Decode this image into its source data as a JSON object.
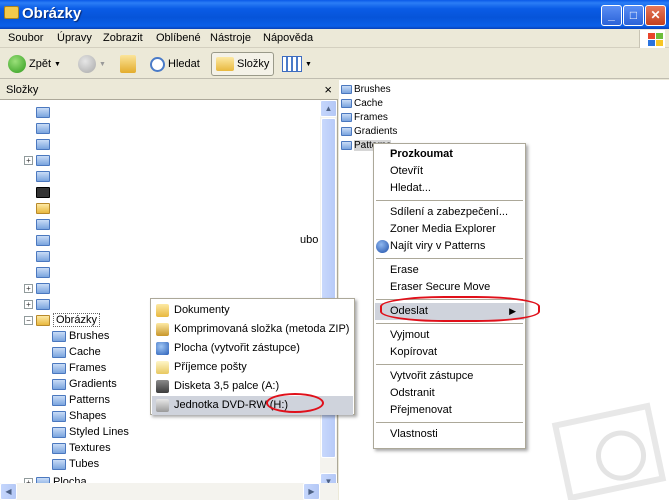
{
  "window": {
    "title": "Obrázky",
    "controls": [
      "minimize",
      "maximize",
      "close"
    ]
  },
  "menubar": [
    "Soubor",
    "Úpravy",
    "Zobrazit",
    "Oblíbené",
    "Nástroje",
    "Nápověda"
  ],
  "toolbar": {
    "back_label": "Zpět",
    "search_label": "Hledat",
    "folders_label": "Složky"
  },
  "folders_pane": {
    "header": "Složky",
    "close_glyph": "×",
    "partial_label": "ubo",
    "selected_folder": "Obrázky",
    "children": [
      "Brushes",
      "Cache",
      "Frames",
      "Gradients",
      "Patterns",
      "Shapes",
      "Styled Lines",
      "Textures",
      "Tubes"
    ],
    "bottom_item": "Plocha"
  },
  "right_pane": {
    "items": [
      "Brushes",
      "Cache",
      "Frames",
      "Gradients",
      "Patterns"
    ]
  },
  "context_menu": {
    "items": [
      {
        "label": "Prozkoumat",
        "bold": true
      },
      {
        "label": "Otevřít"
      },
      {
        "label": "Hledat..."
      },
      {
        "sep": true
      },
      {
        "label": "Sdílení a zabezpečení..."
      },
      {
        "label": "Zoner Media Explorer"
      },
      {
        "label": "Najít viry v Patterns",
        "icon": "antivirus-icon"
      },
      {
        "sep": true
      },
      {
        "label": "Erase"
      },
      {
        "label": "Eraser Secure Move"
      },
      {
        "sep": true
      },
      {
        "label": "Odeslat",
        "submenu": true,
        "selected": true
      },
      {
        "sep": true
      },
      {
        "label": "Vyjmout"
      },
      {
        "label": "Kopírovat"
      },
      {
        "sep": true
      },
      {
        "label": "Vytvořit zástupce"
      },
      {
        "label": "Odstranit"
      },
      {
        "label": "Přejmenovat"
      },
      {
        "sep": true
      },
      {
        "label": "Vlastnosti"
      }
    ]
  },
  "send_to_menu": {
    "items": [
      {
        "label": "Dokumenty",
        "icon": "documents-icon"
      },
      {
        "label": "Komprimovaná složka (metoda ZIP)",
        "icon": "zip-folder-icon"
      },
      {
        "label": "Plocha (vytvořit zástupce)",
        "icon": "desktop-icon"
      },
      {
        "label": "Příjemce pošty",
        "icon": "mail-icon"
      },
      {
        "label": "Disketa 3,5 palce (A:)",
        "icon": "floppy-icon"
      },
      {
        "label": "Jednotka DVD-RW (H:)",
        "icon": "dvd-drive-icon",
        "selected": true
      }
    ]
  },
  "colors": {
    "titlebar": "#0a5ce6",
    "menu_highlight": "#cfd3dc",
    "annotation": "#e0101a"
  }
}
